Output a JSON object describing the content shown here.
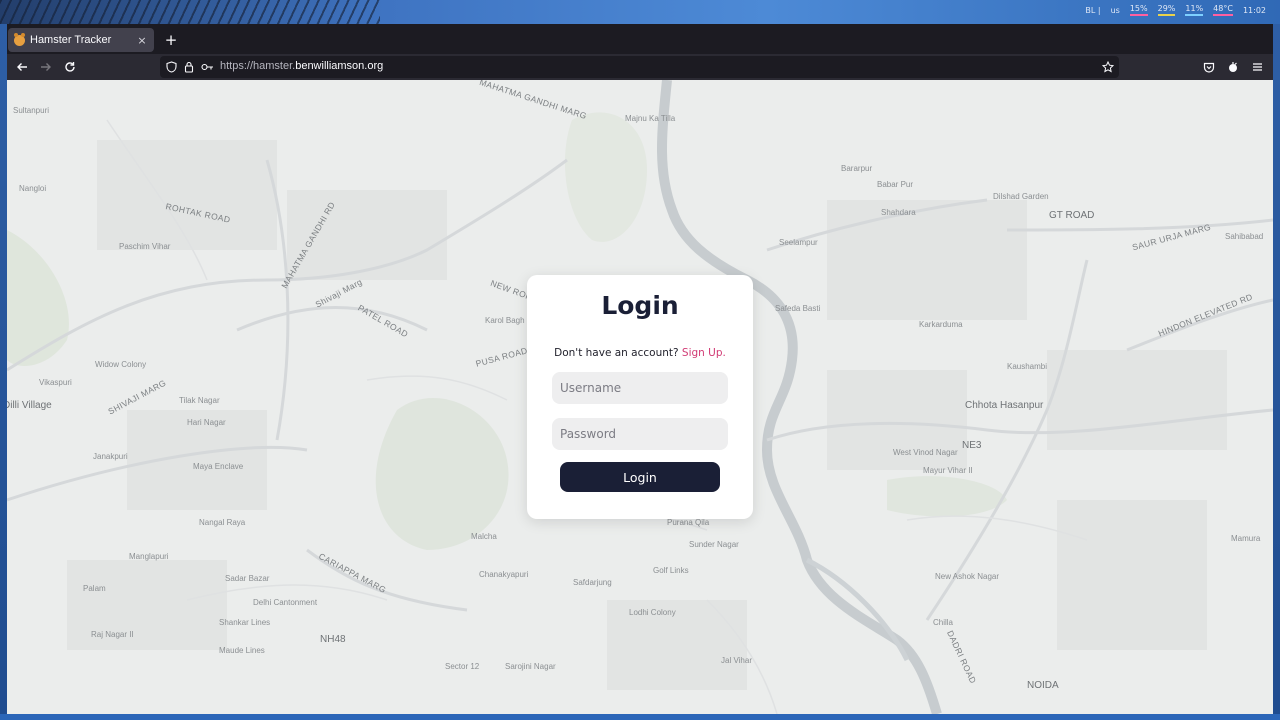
{
  "desktop": {
    "tray": [
      "BL |",
      "us",
      "15%",
      "29%",
      "11%",
      "48°C",
      "11:02"
    ]
  },
  "browser": {
    "tab": {
      "title": "Hamster Tracker",
      "favicon": "hamster-icon",
      "close": "×"
    },
    "new_tab": "+",
    "url": {
      "prefix": "https://hamster.",
      "host": "benwilliamson.org"
    }
  },
  "map": {
    "labels": [
      "Sultanpuri",
      "MAHATMA GANDHI MARG",
      "Majnu Ka Tilla",
      "Nangloi",
      "ROHTAK ROAD",
      "MAHATMA GANDHI RD",
      "Paschim Vihar",
      "Shivaji Marg",
      "PATEL ROAD",
      "NEW ROHTAK",
      "Karol Bagh",
      "PUSA ROAD",
      "Widow Colony",
      "Vikaspuri",
      "SHIVAJI MARG",
      "Tilak Nagar",
      "Hari Nagar",
      "Janakpuri",
      "Maya Enclave",
      "Nangal Raya",
      "Manglapuri",
      "CARIAPPA MARG",
      "Sadar Bazar",
      "Palam",
      "Delhi Cantonment",
      "Shankar Lines",
      "Raj Nagar II",
      "Maude Lines",
      "NH48",
      "Chanakyapuri",
      "Safdarjung",
      "Lodhi Colony",
      "Sector 12",
      "Sarojini Nagar",
      "Jal Vihar",
      "Golf Links",
      "Sunder Nagar",
      "Purana Qila",
      "Malcha",
      "Seelampur",
      "Bararpur",
      "Babar Pur",
      "Shahdara",
      "Dilshad Garden",
      "GT ROAD",
      "SAUR URJA MARG",
      "Sahibabad",
      "HINDON ELEVATED RD",
      "Karkarduma",
      "Kaushambi",
      "Chhota Hasanpur",
      "NE3",
      "West Vinod Nagar",
      "Mayur Vihar II",
      "New Ashok Nagar",
      "Chilla",
      "DADRI ROAD",
      "NOIDA",
      "Mamura",
      "Safeda Basti",
      "Dilli Village"
    ]
  },
  "login": {
    "title": "Login",
    "prompt": "Don't have an account?",
    "signup": "Sign Up.",
    "username_placeholder": "Username",
    "password_placeholder": "Password",
    "button": "Login"
  }
}
